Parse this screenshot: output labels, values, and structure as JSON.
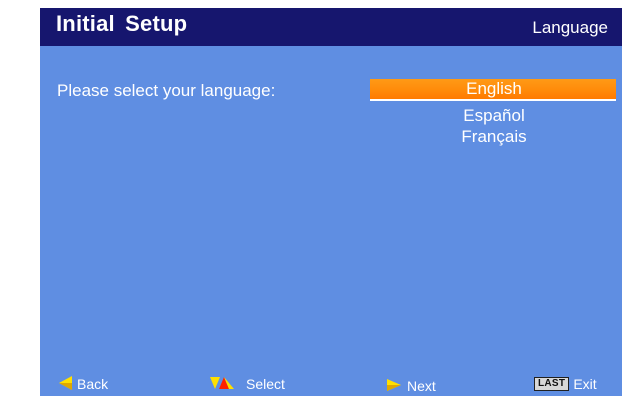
{
  "header": {
    "title": "Initial  Setup",
    "section": "Language"
  },
  "prompt": "Please select your language:",
  "languages": {
    "options": [
      "English",
      "Español",
      "Français"
    ],
    "selected": "English"
  },
  "footer": {
    "back_label": "Back",
    "select_label": "Select",
    "next_label": "Next",
    "exit_key": "LAST",
    "exit_label": "Exit"
  },
  "colors": {
    "background": "#5f8ee2",
    "title_bar": "#16166e",
    "highlight": "#ff8b0a",
    "arrow_yellow": "#ffe000",
    "arrow_red": "#ff2200"
  },
  "icons": [
    "arrow-left-icon",
    "select-arrows-icon",
    "arrow-right-icon",
    "last-key-icon"
  ]
}
